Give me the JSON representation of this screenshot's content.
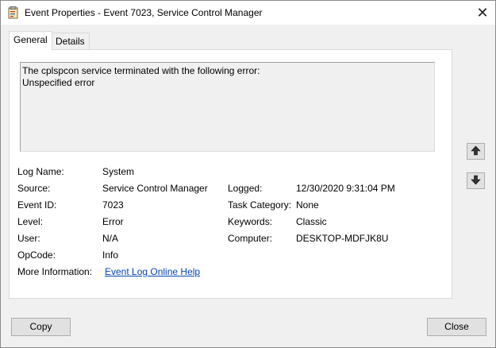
{
  "window": {
    "title": "Event Properties - Event 7023, Service Control Manager",
    "close_glyph": "✕"
  },
  "tabs": [
    {
      "label": "General",
      "active": true
    },
    {
      "label": "Details",
      "active": false
    }
  ],
  "description": {
    "line1": "The cplspcon service terminated with the following error:",
    "line2": "Unspecified error"
  },
  "fields": {
    "log_name": {
      "label": "Log Name:",
      "value": "System"
    },
    "source": {
      "label": "Source:",
      "value": "Service Control Manager"
    },
    "logged": {
      "label": "Logged:",
      "value": "12/30/2020 9:31:04 PM"
    },
    "event_id": {
      "label": "Event ID:",
      "value": "7023"
    },
    "task_category": {
      "label": "Task Category:",
      "value": "None"
    },
    "level": {
      "label": "Level:",
      "value": "Error"
    },
    "keywords": {
      "label": "Keywords:",
      "value": "Classic"
    },
    "user": {
      "label": "User:",
      "value": "N/A"
    },
    "computer": {
      "label": "Computer:",
      "value": "DESKTOP-MDFJK8U"
    },
    "opcode": {
      "label": "OpCode:",
      "value": "Info"
    },
    "more_info": {
      "label": "More Information:",
      "value": "Event Log Online Help"
    }
  },
  "nav": {
    "up_icon": "arrow-up-icon",
    "down_icon": "arrow-down-icon"
  },
  "buttons": {
    "copy": "Copy",
    "close": "Close"
  },
  "colors": {
    "link": "#0645ad",
    "window_bg": "#f0f0f0",
    "panel_bg": "#ffffff"
  }
}
